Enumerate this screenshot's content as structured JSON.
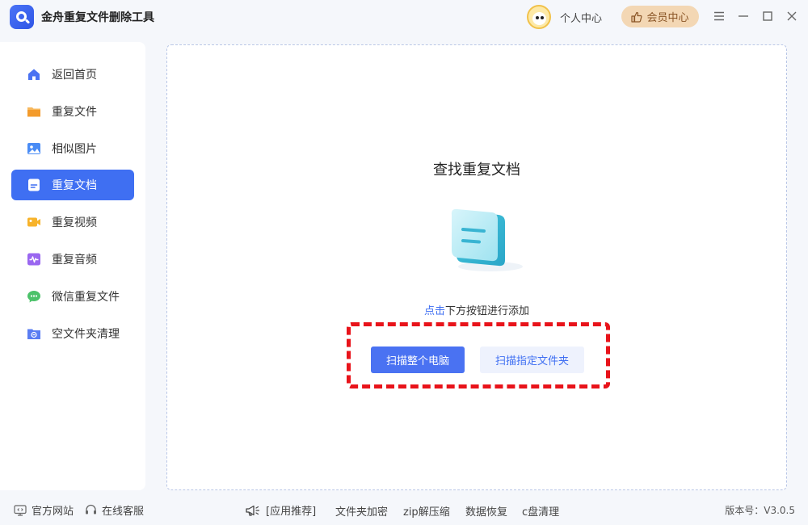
{
  "app": {
    "title": "金舟重复文件删除工具"
  },
  "header": {
    "user_label": "个人中心",
    "vip_label": "会员中心",
    "window_controls": [
      "menu-icon",
      "minimize-icon",
      "maximize-icon",
      "close-icon"
    ]
  },
  "sidebar": {
    "items": [
      {
        "label": "返回首页",
        "icon": "home-icon",
        "active": false
      },
      {
        "label": "重复文件",
        "icon": "folder-icon",
        "active": false
      },
      {
        "label": "相似图片",
        "icon": "image-icon",
        "active": false
      },
      {
        "label": "重复文档",
        "icon": "document-icon",
        "active": true
      },
      {
        "label": "重复视频",
        "icon": "video-icon",
        "active": false
      },
      {
        "label": "重复音频",
        "icon": "audio-icon",
        "active": false
      },
      {
        "label": "微信重复文件",
        "icon": "wechat-icon",
        "active": false
      },
      {
        "label": "空文件夹清理",
        "icon": "empty-folder-icon",
        "active": false
      }
    ]
  },
  "main": {
    "title": "查找重复文档",
    "hint_link": "点击",
    "hint_text": "下方按钮进行添加",
    "scan_all_label": "扫描整个电脑",
    "scan_folder_label": "扫描指定文件夹"
  },
  "footer": {
    "website_label": "官方网站",
    "service_label": "在线客服",
    "recommend_label": "[应用推荐]",
    "links": [
      "文件夹加密",
      "zip解压缩",
      "数据恢复",
      "c盘清理"
    ],
    "version": "版本号：V3.0.5"
  },
  "colors": {
    "accent": "#3f6ff2",
    "vip_bg": "#f3d7b4",
    "highlight_frame": "#e8131a"
  }
}
